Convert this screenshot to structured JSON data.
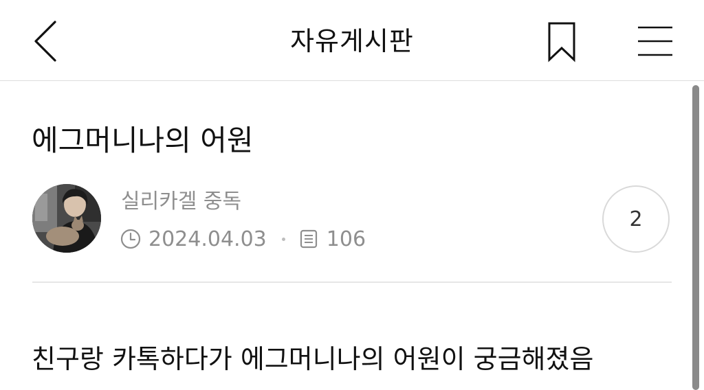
{
  "header": {
    "board_title": "자유게시판",
    "icons": {
      "back": "chevron-left-icon",
      "bookmark": "bookmark-icon",
      "menu": "hamburger-menu-icon"
    }
  },
  "post": {
    "title": "에그머니나의 어원",
    "author": "실리카겔 중독",
    "date": "2024.04.03",
    "views": "106",
    "comment_count": "2",
    "body_first_line": "친구랑 카톡하다가 에그머니나의 어원이 궁금해졌음"
  },
  "colors": {
    "text_primary": "#111111",
    "text_secondary": "#8e8e8e",
    "divider": "#e6e6e6",
    "scrollbar": "#8a8a8a"
  }
}
